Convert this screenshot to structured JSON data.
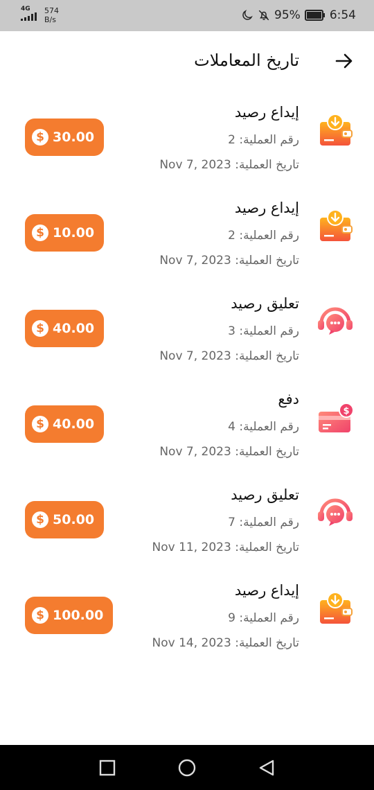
{
  "status_bar": {
    "network": "4G",
    "speed_value": "574",
    "speed_unit": "B/s",
    "battery": "95%",
    "time": "6:54"
  },
  "header": {
    "title": "تاريخ المعاملات"
  },
  "labels": {
    "op_number": "رقم العملية:",
    "op_date": "تاريخ العملية:"
  },
  "transactions": [
    {
      "type": "إيداع رصيد",
      "icon": "wallet-deposit-icon",
      "op_number": "2",
      "date": "Nov 7, 2023",
      "amount": "30.00"
    },
    {
      "type": "إيداع رصيد",
      "icon": "wallet-deposit-icon",
      "op_number": "2",
      "date": "Nov 7, 2023",
      "amount": "10.00"
    },
    {
      "type": "تعليق رصيد",
      "icon": "support-headset-icon",
      "op_number": "3",
      "date": "Nov 7, 2023",
      "amount": "40.00"
    },
    {
      "type": "دفع",
      "icon": "card-payment-icon",
      "op_number": "4",
      "date": "Nov 7, 2023",
      "amount": "40.00"
    },
    {
      "type": "تعليق رصيد",
      "icon": "support-headset-icon",
      "op_number": "7",
      "date": "Nov 11, 2023",
      "amount": "50.00"
    },
    {
      "type": "إيداع رصيد",
      "icon": "wallet-deposit-icon",
      "op_number": "9",
      "date": "Nov 14, 2023",
      "amount": "100.00"
    }
  ],
  "colors": {
    "accent": "#f47c2f",
    "status_bar": "#c9c9c9",
    "nav_bar": "#000000"
  }
}
